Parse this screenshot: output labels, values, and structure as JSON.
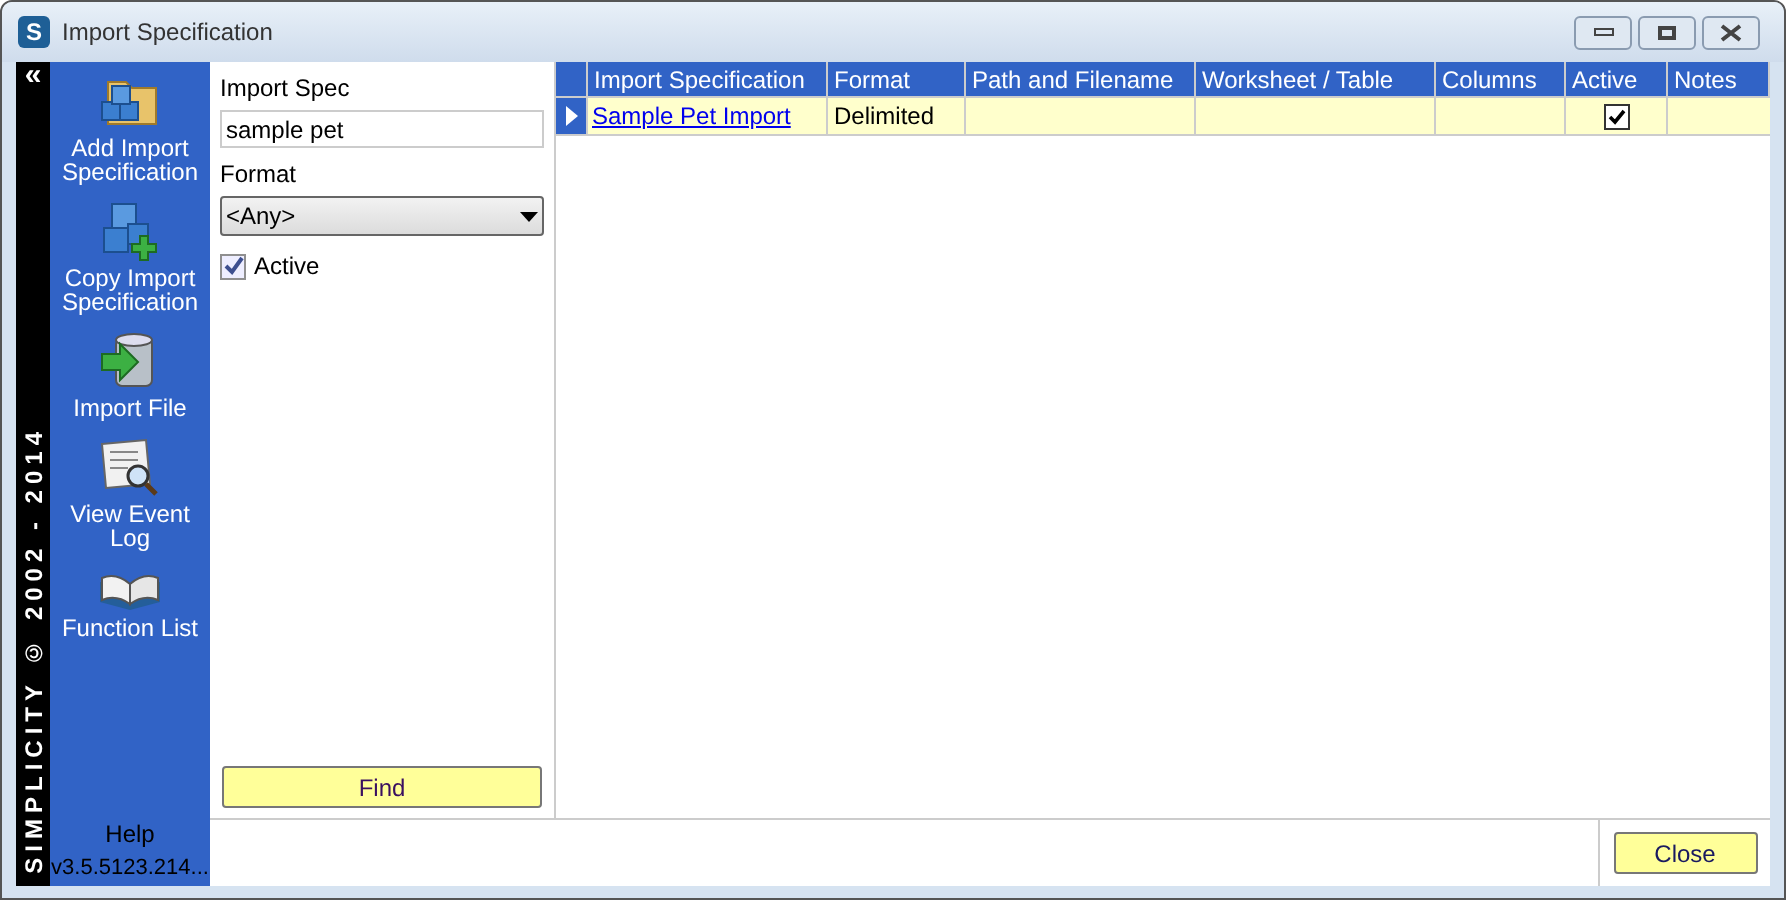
{
  "window": {
    "title": "Import Specification",
    "app_icon_letter": "S"
  },
  "side_strip": {
    "collapse_glyph": "«",
    "caption": "SIMPLICITY © 2002 - 2014"
  },
  "sidebar": {
    "items": [
      {
        "label": "Add Import Specification",
        "kind": "add"
      },
      {
        "label": "Copy Import Specification",
        "kind": "copy"
      },
      {
        "label": "Import File",
        "kind": "import"
      },
      {
        "label": "View Event Log",
        "kind": "log"
      },
      {
        "label": "Function List",
        "kind": "book"
      }
    ],
    "help": "Help",
    "version": "v3.5.5123.214..."
  },
  "filter": {
    "spec_label": "Import Spec",
    "spec_value": "sample pet",
    "format_label": "Format",
    "format_value": "<Any>",
    "active_label": "Active",
    "active_checked": true,
    "find_button": "Find"
  },
  "table": {
    "columns": [
      "Import Specification",
      "Format",
      "Path and Filename",
      "Worksheet / Table",
      "Columns",
      "Active",
      "Notes"
    ],
    "rows": [
      {
        "name": "Sample Pet Import",
        "format": "Delimited",
        "path": "",
        "worksheet": "",
        "columns": "",
        "active": true,
        "notes": "",
        "selected": true
      }
    ]
  },
  "footer": {
    "close_button": "Close"
  }
}
